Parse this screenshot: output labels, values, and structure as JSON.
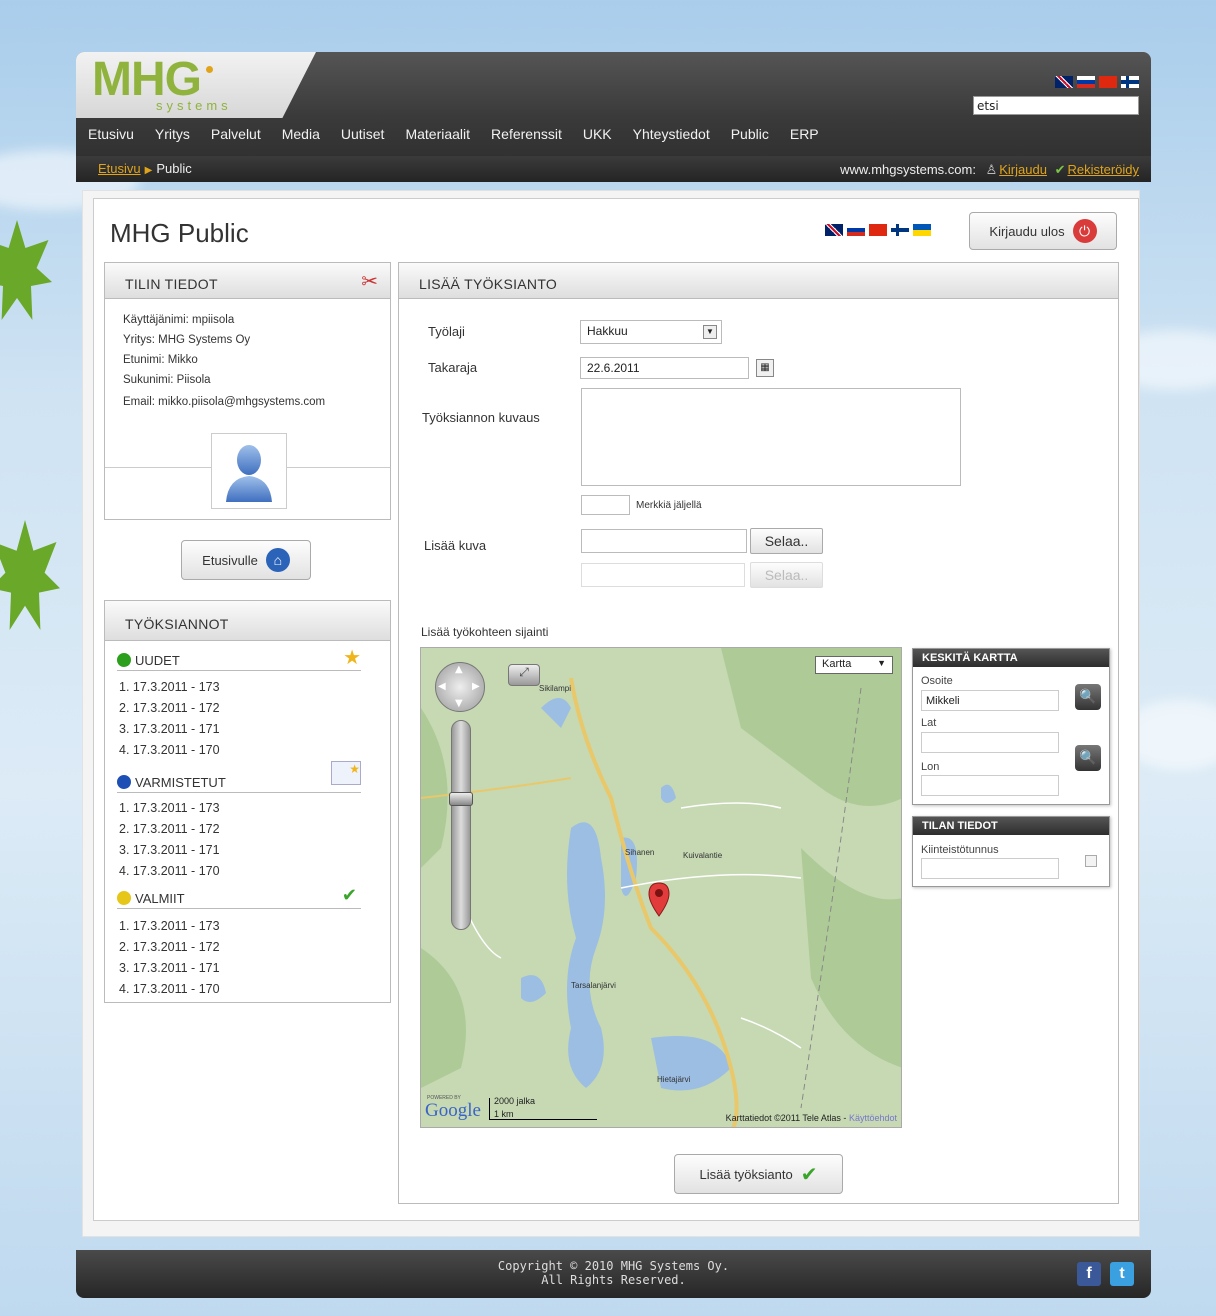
{
  "header": {
    "logo_text": "MHG",
    "logo_subtext": "systems",
    "search_value": "etsi",
    "nav": [
      "Etusivu",
      "Yritys",
      "Palvelut",
      "Media",
      "Uutiset",
      "Materiaalit",
      "Referenssit",
      "UKK",
      "Yhteystiedot",
      "Public",
      "ERP"
    ],
    "breadcrumb": {
      "home": "Etusivu",
      "current": "Public"
    },
    "site": "www.mhgsystems.com:",
    "login": "Kirjaudu",
    "register": "Rekisteröidy"
  },
  "page": {
    "title": "MHG Public",
    "logout": "Kirjaudu ulos"
  },
  "account": {
    "header": "TILIN TIEDOT",
    "lines": [
      "Käyttäjänimi: mpiisola",
      "Yritys: MHG Systems Oy",
      "Etunimi: Mikko",
      "Sukunimi: Piisola",
      "Email: mikko.piisola@mhgsystems.com"
    ],
    "home_button": "Etusivulle"
  },
  "assignments": {
    "header": "TYÖKSIANNOT",
    "groups": [
      {
        "title": "UUDET",
        "color": "#2ca01c",
        "items": [
          "1. 17.3.2011 - 173",
          "2. 17.3.2011 - 172",
          "3. 17.3.2011 - 171",
          "4. 17.3.2011 - 170"
        ]
      },
      {
        "title": "VARMISTETUT",
        "color": "#1e4fb5",
        "items": [
          "1. 17.3.2011 - 173",
          "2. 17.3.2011 - 172",
          "3. 17.3.2011 - 171",
          "4. 17.3.2011 - 170"
        ]
      },
      {
        "title": "VALMIIT",
        "color": "#e6c619",
        "items": [
          "1. 17.3.2011 - 173",
          "2. 17.3.2011 - 172",
          "3. 17.3.2011 - 171",
          "4. 17.3.2011 - 170"
        ]
      }
    ]
  },
  "form": {
    "header": "LISÄÄ TYÖKSIANTO",
    "worktype_label": "Työlaji",
    "worktype_value": "Hakkuu",
    "deadline_label": "Takaraja",
    "deadline_value": "22.6.2011",
    "description_label": "Työksiannon kuvaus",
    "chars_left": "Merkkiä jäljellä",
    "image_label": "Lisää kuva",
    "browse": "Selaa..",
    "location_label": "Lisää työkohteen sijainti",
    "submit": "Lisää työksianto"
  },
  "map": {
    "type_select": "Kartta",
    "labels": [
      "Sikilampi",
      "Sihanen",
      "Tarsalanjärvi",
      "Hietajärvi",
      "Kuivalantie"
    ],
    "scale_ft": "2000 jalka",
    "scale_km": "1 km",
    "google_powered": "POWERED BY",
    "google": "Google",
    "attribution": "Karttatiedot ©2011 Tele Atlas -",
    "terms": "Käyttöehdot"
  },
  "center_box": {
    "header": "KESKITÄ KARTTA",
    "address_label": "Osoite",
    "address_value": "Mikkeli",
    "lat_label": "Lat",
    "lon_label": "Lon"
  },
  "property_box": {
    "header": "TILAN TIEDOT",
    "id_label": "Kiinteistötunnus"
  },
  "footer": {
    "line1": "Copyright © 2010 MHG Systems Oy.",
    "line2": "All Rights Reserved."
  }
}
